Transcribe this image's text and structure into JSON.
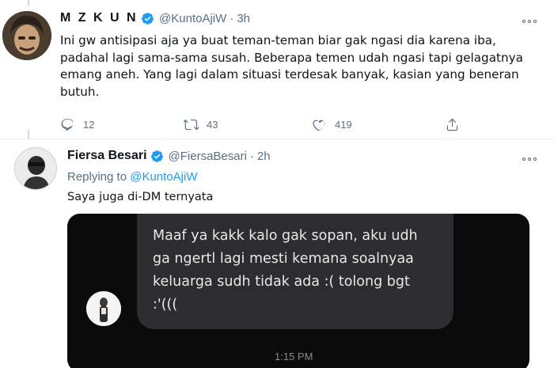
{
  "tweet1": {
    "name": "M Z K U N",
    "handle": "@KuntoAjiW",
    "separator": "·",
    "time": "3h",
    "text": "Ini gw antisipasi aja ya buat teman-teman biar gak ngasi dia karena iba, padahal lagi sama-sama susah. Beberapa temen udah ngasi tapi gelagatnya emang aneh. Yang lagi dalam situasi terdesak banyak, kasian yang beneran butuh.",
    "replies": "12",
    "retweets": "43",
    "likes": "419"
  },
  "tweet2": {
    "name": "Fiersa Besari",
    "handle": "@FiersaBesari",
    "separator": "·",
    "time": "2h",
    "replying_prefix": "Replying to ",
    "replying_to": "@KuntoAjiW",
    "text": "Saya juga di-DM ternyata"
  },
  "dm_screenshot": {
    "message": "Maaf ya kakk kalo gak sopan, aku udh ga ngertl lagi mesti kemana soalnyaa keluarga sudh tidak ada :( tolong bgt :'(((",
    "time": "1:15 PM"
  },
  "icons": {
    "verified": "verified-badge-icon",
    "reply": "reply-icon",
    "retweet": "retweet-icon",
    "like": "heart-icon",
    "share": "share-icon",
    "more": "more-icon"
  },
  "colors": {
    "accent": "#1d9bf0",
    "muted": "#5b7083",
    "text": "#0f1419",
    "dm_background": "#0b0b0c",
    "dm_bubble": "#2d2d30"
  }
}
